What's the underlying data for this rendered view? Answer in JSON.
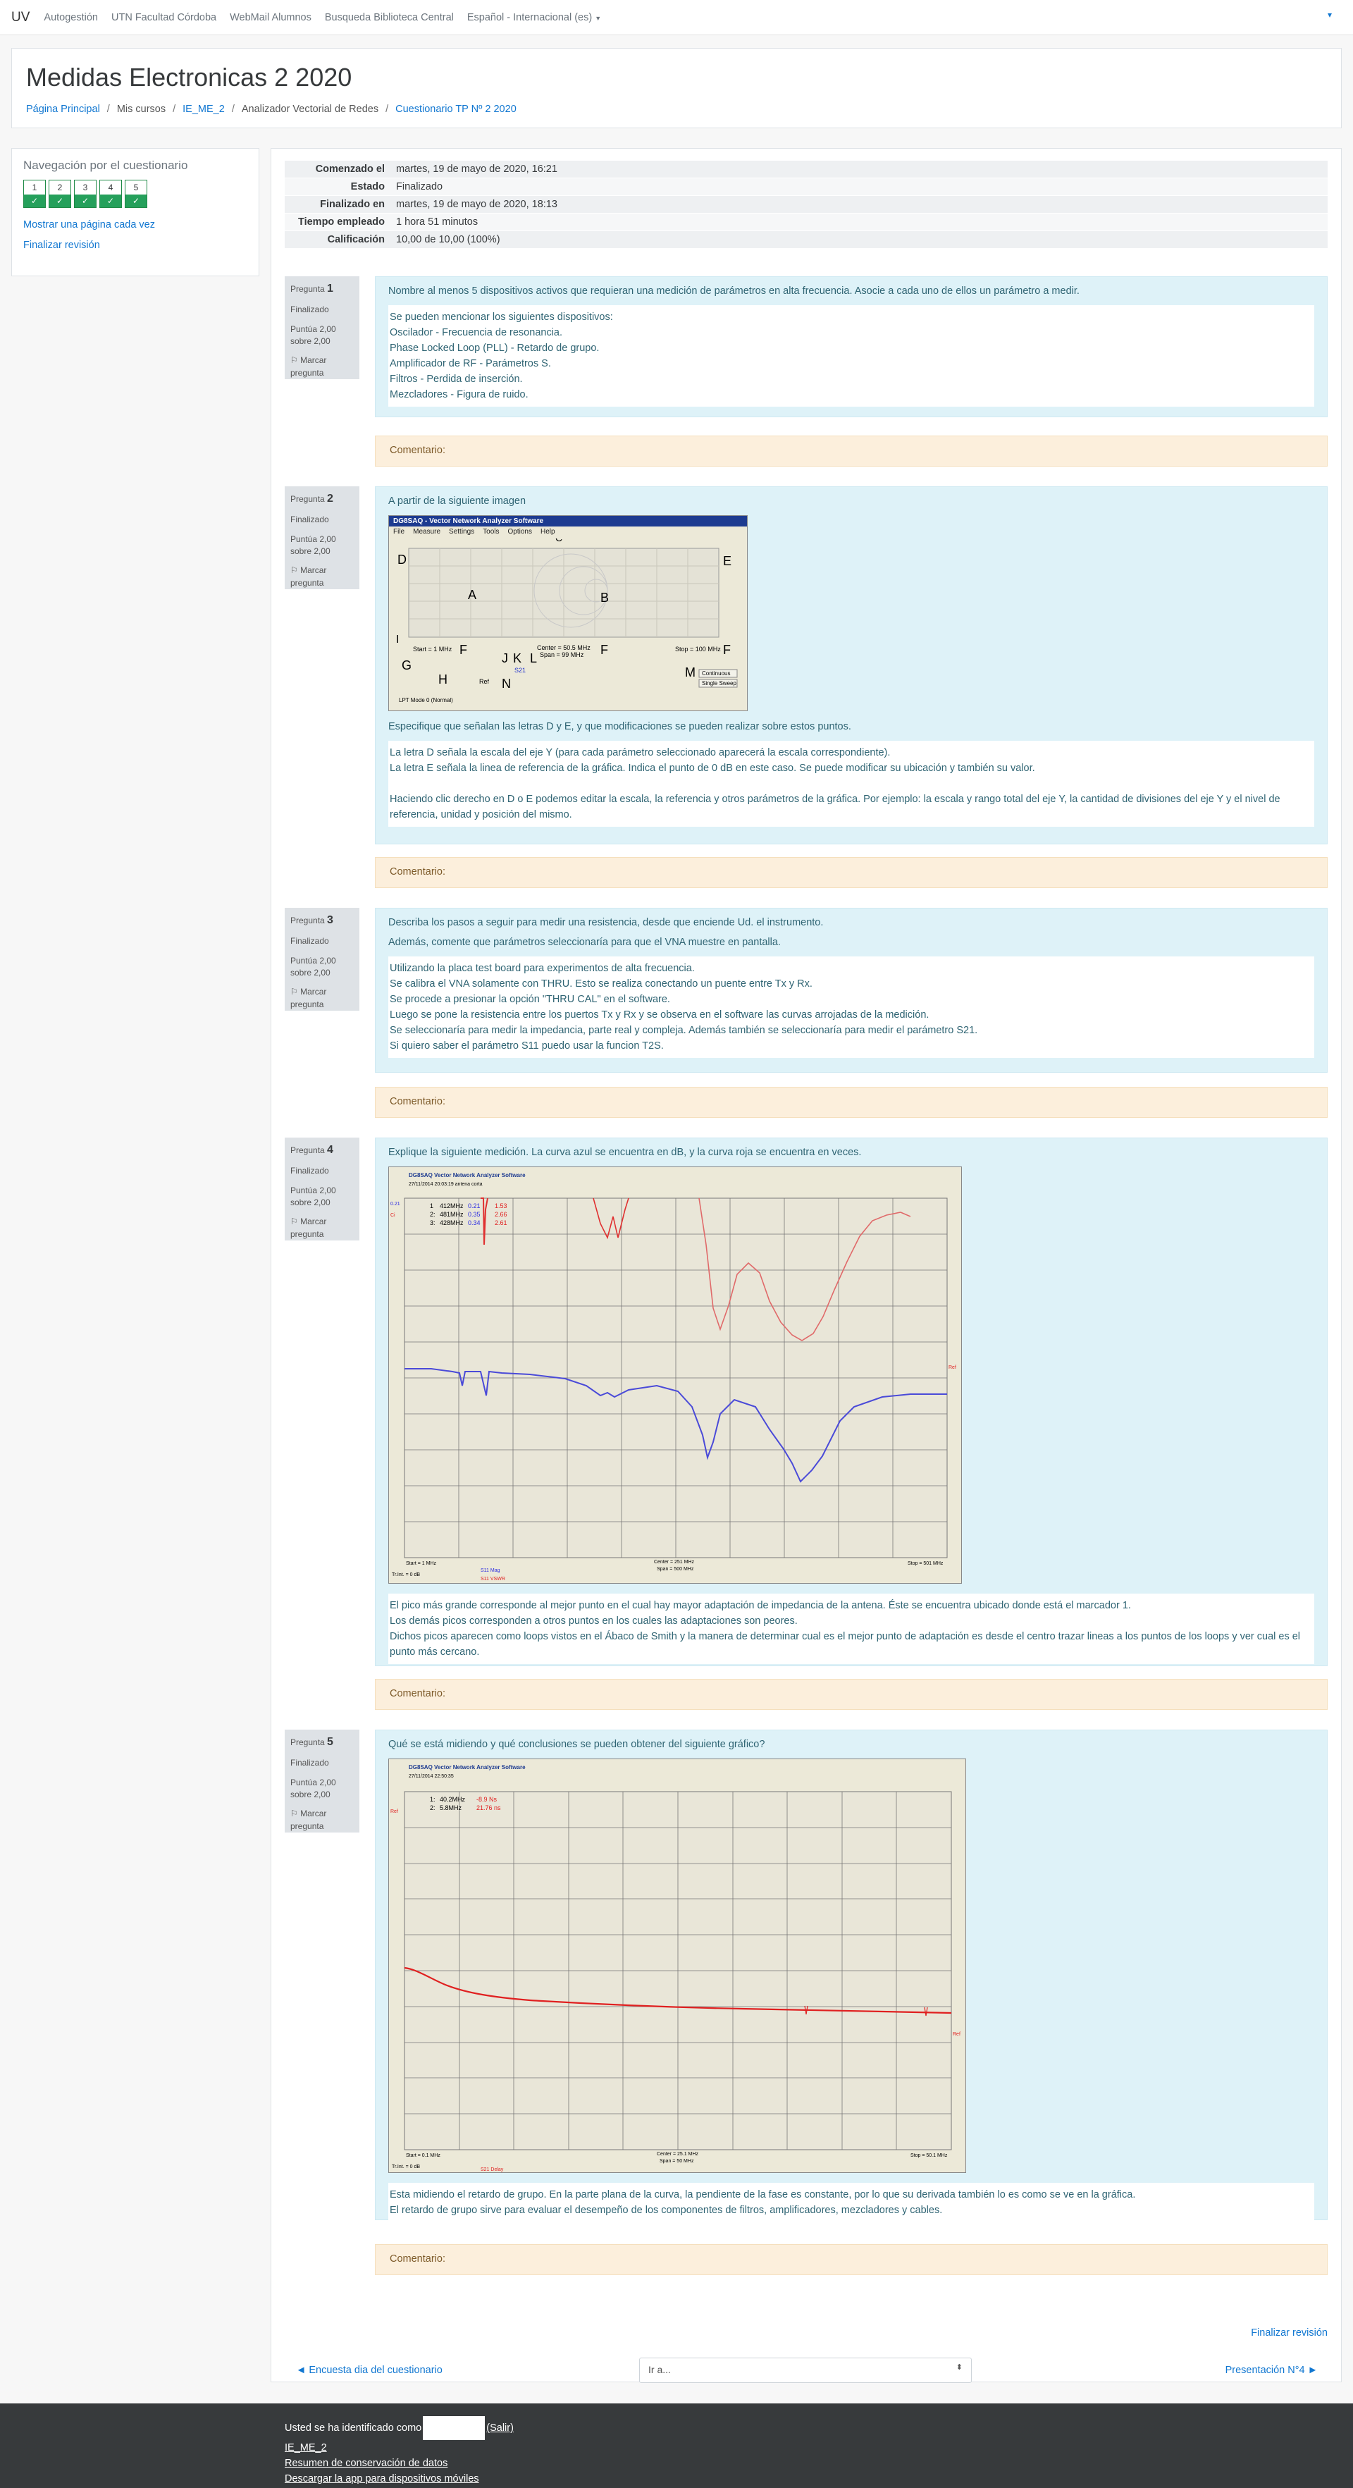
{
  "navbar": {
    "brand": "UV",
    "links": [
      "Autogestión",
      "UTN Facultad Córdoba",
      "WebMail Alumnos",
      "Busqueda Biblioteca Central",
      "Español - Internacional (es)"
    ]
  },
  "header": {
    "title": "Medidas Electronicas 2 2020",
    "breadcrumb": [
      "Página Principal",
      "Mis cursos",
      "IE_ME_2",
      "Analizador Vectorial de Redes",
      "Cuestionario TP Nº 2 2020"
    ]
  },
  "nav_block": {
    "title": "Navegación por el cuestionario",
    "buttons": [
      "1",
      "2",
      "3",
      "4",
      "5"
    ],
    "check": "✓",
    "show_one": "Mostrar una página cada vez",
    "finish": "Finalizar revisión"
  },
  "summary": [
    {
      "k": "Comenzado el",
      "v": "martes, 19 de mayo de 2020, 16:21"
    },
    {
      "k": "Estado",
      "v": "Finalizado"
    },
    {
      "k": "Finalizado en",
      "v": "martes, 19 de mayo de 2020, 18:13"
    },
    {
      "k": "Tiempo empleado",
      "v": "1 hora 51 minutos"
    },
    {
      "k": "Calificación",
      "v": "10,00 de 10,00 (100%)"
    }
  ],
  "qinfo": {
    "label": "Pregunta",
    "state": "Finalizado",
    "score": "Puntúa 2,00 sobre 2,00",
    "flag": "Marcar pregunta"
  },
  "comment_label": "Comentario:",
  "questions": [
    {
      "no": "1",
      "text": "Nombre al menos 5 dispositivos activos que requieran una medición de parámetros en alta frecuencia. Asocie a cada uno de ellos un parámetro a medir.",
      "answer": [
        "Se pueden mencionar los siguientes dispositivos:",
        "Oscilador - Frecuencia de resonancia.",
        "Phase Locked Loop (PLL) - Retardo de grupo.",
        "Amplificador de RF - Parámetros S.",
        "Filtros - Perdida de inserción.",
        "Mezcladores - Figura de ruido."
      ]
    },
    {
      "no": "2",
      "text": "A partir de la siguiente imagen",
      "text2": "Especifique que señalan las letras D y E, y que modificaciones se pueden realizar sobre estos puntos.",
      "answer": [
        "La letra D señala la escala del eje Y (para cada parámetro seleccionado aparecerá la escala correspondiente).",
        "La letra E señala la linea de referencia de la gráfica. Indica el punto de 0 dB en este caso. Se puede modificar su ubicación y también su valor.",
        "",
        "Haciendo clic derecho en D o E podemos editar la escala, la referencia y otros parámetros de la gráfica. Por ejemplo: la escala y rango total del eje Y, la cantidad de divisiones del eje Y y el nivel de referencia, unidad y posición del mismo."
      ]
    },
    {
      "no": "3",
      "text": "Describa los pasos a seguir para medir una resistencia, desde que enciende Ud. el instrumento.",
      "text2": "Además, comente que parámetros seleccionaría para que el VNA muestre en pantalla.",
      "answer": [
        "Utilizando la placa test board para experimentos de alta frecuencia.",
        "Se calibra el VNA solamente con THRU. Esto se realiza conectando un puente entre Tx y Rx.",
        "Se procede a presionar la opción \"THRU CAL\" en el software.",
        "Luego se pone la resistencia entre los puertos Tx y Rx y se observa en el software las curvas arrojadas de la medición.",
        "Se seleccionaría para medir la impedancia, parte real y compleja. Además también se seleccionaría para medir el parámetro S21.",
        "Si quiero saber el parámetro S11 puedo usar la funcion T2S."
      ]
    },
    {
      "no": "4",
      "text": "Explique la siguiente medición.  La curva azul se encuentra en dB, y la curva roja se encuentra en veces.",
      "answer": [
        "El pico más grande corresponde al mejor punto en el cual hay mayor adaptación de impedancia de la antena. Éste se encuentra ubicado donde está el marcador 1.",
        "Los demás picos corresponden a otros puntos en los cuales las adaptaciones son peores.",
        "Dichos picos aparecen como loops vistos en el Ábaco de Smith y la manera de determinar cual es el mejor punto de adaptación es desde el centro trazar lineas a los puntos de los loops y ver cual es el punto más cercano."
      ]
    },
    {
      "no": "5",
      "text": "Qué se está midiendo y qué conclusiones se pueden obtener del siguiente gráfico?",
      "answer": [
        "Esta midiendo el retardo de grupo. En la parte plana de la curva, la pendiente de la fase es constante, por lo que su derivada también lo es como se ve en la gráfica.",
        "El retardo de grupo sirve para evaluar el desempeño de los componentes de filtros, amplificadores, mezcladores y cables."
      ]
    }
  ],
  "img2": {
    "title": "DG8SAQ - Vector Network Analyzer Software",
    "menu": [
      "File",
      "Measure",
      "Settings",
      "Tools",
      "Options",
      "Help"
    ],
    "letters": {
      "A": "A",
      "B": "B",
      "C": "C",
      "D": "D",
      "E": "E",
      "F": "F",
      "G": "G",
      "H": "H",
      "I": "I",
      "J": "J",
      "K": "K",
      "L": "L",
      "M": "M",
      "N": "N"
    },
    "start": "Start = 1 MHz",
    "center": "Center = 50.5 MHz",
    "span": "Span = 99 MHz",
    "stop": "Stop = 100 MHz",
    "s21": "S21",
    "continuous": "Continuous",
    "single": "Single Sweep",
    "lpt": "LPT Mode 0 (Normal)",
    "ref": "Ref"
  },
  "img4": {
    "title": "DG8SAQ Vector Network Analyzer Software",
    "date": "27/11/2014   20:03:19    antena corta",
    "markers": [
      {
        "n": "1",
        "f": "412MHz",
        "b": "0.21",
        "r": "1.53"
      },
      {
        "n": "2:",
        "f": "481MHz",
        "b": "0.35",
        "r": "2.66"
      },
      {
        "n": "3:",
        "f": "428MHz",
        "b": "0.34",
        "r": "2.61"
      }
    ],
    "start": "Start = 1 MHz",
    "center": "Center = 251 MHz",
    "span": "Span = 500 MHz",
    "stop": "Stop = 501 MHz",
    "leg1": "S11 Mag",
    "leg2": "S11 VSWR",
    "tr": "Tr.Int. = 0 dB",
    "ref": "Ref",
    "scale_blue": "0.21",
    "scale_red": "Ci"
  },
  "img5": {
    "title": "DG8SAQ Vector Network Analyzer Software",
    "date": "27/11/2014   22:50:35",
    "markers": [
      {
        "n": "1:",
        "f": "40.2MHz",
        "v": "-8.9 Ns"
      },
      {
        "n": "2:",
        "f": "5.8MHz",
        "v": "21.76 ns"
      }
    ],
    "start": "Start = 0.1 MHz",
    "center": "Center = 25.1 MHz",
    "span": "Span = 50 MHz",
    "stop": "Stop = 50.1 MHz",
    "leg": "S21 Delay",
    "tr": "Tr.Int. = 0 dB",
    "ref": "Ref"
  },
  "nav_bottom": {
    "prev": "◄ Encuesta dia del cuestionario",
    "select": "Ir a...",
    "next": "Presentación N°4 ►",
    "finish": "Finalizar revisión"
  },
  "footer": {
    "logged_a": "Usted se ha identificado como",
    "logged_b": "(Salir)",
    "course": "IE_ME_2",
    "retention": "Resumen de conservación de datos",
    "app": "Descargar la app para dispositivos móviles"
  }
}
